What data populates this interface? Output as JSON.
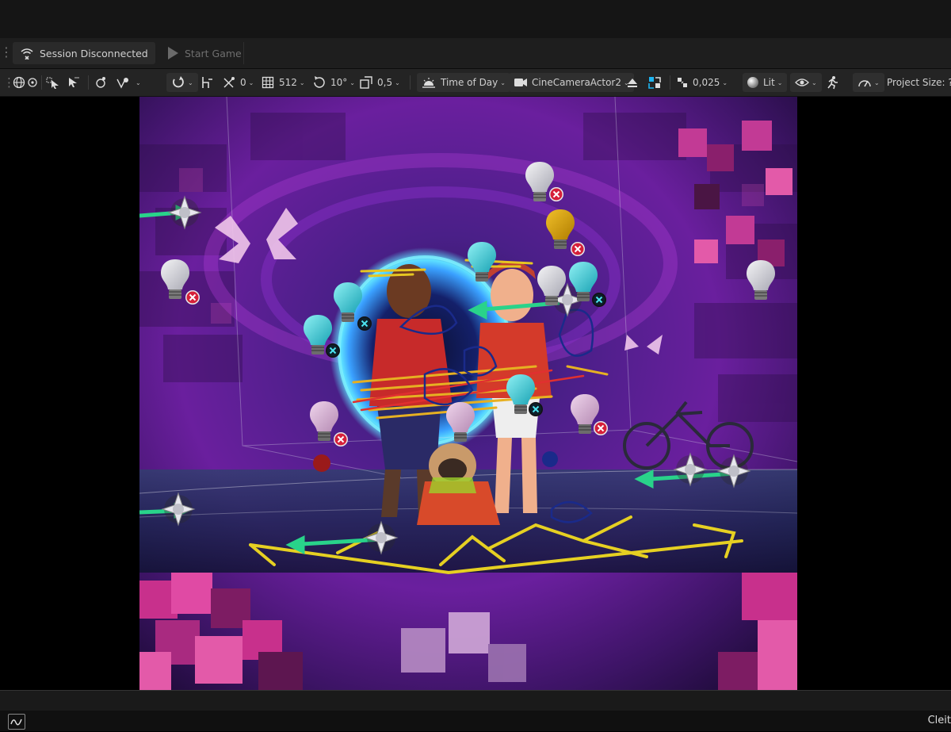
{
  "session": {
    "status_label": "Session Disconnected",
    "start_game_label": "Start Game"
  },
  "toolbar": {
    "snap_translate_value": "0",
    "grid_size_value": "512",
    "rotation_snap_value": "10°",
    "scale_snap_value": "0,5",
    "time_of_day_label": "Time of Day",
    "camera_label": "CineCameraActor2",
    "camera_speed_value": "0,025",
    "view_mode_label": "Lit",
    "project_size_label": "Project Size: ??"
  },
  "statusbar": {
    "right_text": "Cleit"
  },
  "colors": {
    "accent": "#1fb5f0",
    "background": "#151515",
    "toolbar": "#242424"
  },
  "icons": [
    "wifi-off-icon",
    "play-icon",
    "globe-icon",
    "select-icon",
    "transform-icon",
    "snap-icon",
    "grid-icon",
    "rotate-icon",
    "scale-icon",
    "sun-icon",
    "camera-icon",
    "eject-icon",
    "lit-sphere-icon",
    "eye-icon",
    "runner-icon",
    "settings-icon",
    "light-bulb-icon",
    "error-icon",
    "directional-light-icon"
  ]
}
